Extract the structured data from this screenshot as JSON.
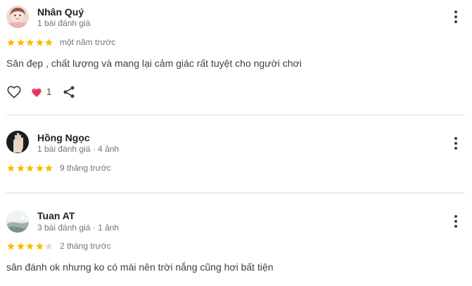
{
  "colors": {
    "star_filled": "#fbbc04",
    "star_empty": "#dadce0",
    "heart": "#e8305e",
    "icon": "#3c4043",
    "meta_text": "#70757a",
    "divider": "#dadce0"
  },
  "reviews": [
    {
      "author": "Nhân Quý",
      "meta": "1 bài đánh giá",
      "rating": 5,
      "date": "một năm trước",
      "text": "Sân đẹp , chất lượng và mang lại cảm giác rất tuyệt cho người chơi",
      "like_count": "1",
      "icons": [
        "avatar-photo",
        "more-vert-icon",
        "heart-outline-icon",
        "heart-filled-icon",
        "share-icon"
      ]
    },
    {
      "author": "Hồng Ngọc",
      "meta": "1 bài đánh giá · 4 ảnh",
      "rating": 5,
      "date": "9 tháng trước",
      "icons": [
        "avatar-photo",
        "more-vert-icon"
      ]
    },
    {
      "author": "Tuan AT",
      "meta": "3 bài đánh giá · 1 ảnh",
      "rating": 4,
      "date": "2 tháng trước",
      "text": "sân đánh ok nhưng ko có mái nên trời nắng cũng hơi bất tiện",
      "icons": [
        "avatar-photo",
        "more-vert-icon"
      ]
    }
  ]
}
